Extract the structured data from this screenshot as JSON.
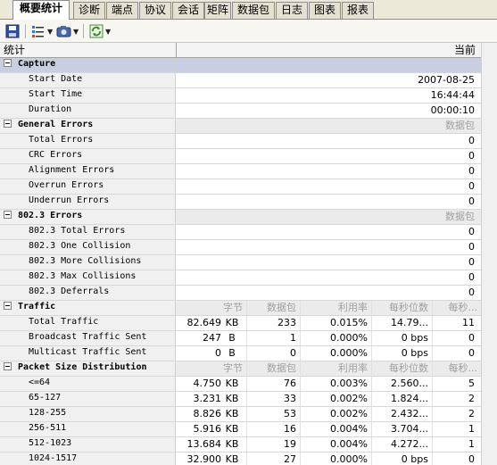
{
  "tabs": [
    "概要统计",
    "诊断",
    "端点",
    "协议",
    "会话",
    "矩阵",
    "数据包",
    "日志",
    "图表",
    "报表"
  ],
  "header": {
    "col_stat": "统计",
    "col_current": "当前"
  },
  "capture": {
    "title": "Capture",
    "start_date_label": "Start Date",
    "start_date": "2007-08-25",
    "start_time_label": "Start Time",
    "start_time": "16:44:44",
    "duration_label": "Duration",
    "duration": "00:00:10"
  },
  "general_errors": {
    "title": "General Errors",
    "unit": "数据包",
    "rows": [
      {
        "label": "Total Errors",
        "value": "0"
      },
      {
        "label": "CRC Errors",
        "value": "0"
      },
      {
        "label": "Alignment Errors",
        "value": "0"
      },
      {
        "label": "Overrun Errors",
        "value": "0"
      },
      {
        "label": "Underrun Errors",
        "value": "0"
      }
    ]
  },
  "errors_8023": {
    "title": "802.3 Errors",
    "unit": "数据包",
    "rows": [
      {
        "label": "802.3 Total Errors",
        "value": "0"
      },
      {
        "label": "802.3 One Collision",
        "value": "0"
      },
      {
        "label": "802.3 More Collisions",
        "value": "0"
      },
      {
        "label": "802.3 Max Collisions",
        "value": "0"
      },
      {
        "label": "802.3 Deferrals",
        "value": "0"
      }
    ]
  },
  "traffic": {
    "title": "Traffic",
    "cols": [
      "字节",
      "数据包",
      "利用率",
      "每秒位数",
      "每秒..."
    ],
    "rows": [
      {
        "label": "Total Traffic",
        "bytes": "82.649",
        "bu": "KB",
        "packets": "233",
        "util": "0.015%",
        "bps": "14.79...",
        "pps": "11"
      },
      {
        "label": "Broadcast Traffic Sent",
        "bytes": "247",
        "bu": "B",
        "packets": "1",
        "util": "0.000%",
        "bps": "0 bps",
        "pps": "0"
      },
      {
        "label": "Multicast Traffic Sent",
        "bytes": "0",
        "bu": "B",
        "packets": "0",
        "util": "0.000%",
        "bps": "0 bps",
        "pps": "0"
      }
    ]
  },
  "psd": {
    "title": "Packet Size Distribution",
    "cols": [
      "字节",
      "数据包",
      "利用率",
      "每秒位数",
      "每秒..."
    ],
    "rows": [
      {
        "label": "<=64",
        "bytes": "4.750",
        "bu": "KB",
        "packets": "76",
        "util": "0.003%",
        "bps": "2.560...",
        "pps": "5"
      },
      {
        "label": "65-127",
        "bytes": "3.231",
        "bu": "KB",
        "packets": "33",
        "util": "0.002%",
        "bps": "1.824...",
        "pps": "2"
      },
      {
        "label": "128-255",
        "bytes": "8.826",
        "bu": "KB",
        "packets": "53",
        "util": "0.002%",
        "bps": "2.432...",
        "pps": "2"
      },
      {
        "label": "256-511",
        "bytes": "5.916",
        "bu": "KB",
        "packets": "16",
        "util": "0.004%",
        "bps": "3.704...",
        "pps": "1"
      },
      {
        "label": "512-1023",
        "bytes": "13.684",
        "bu": "KB",
        "packets": "19",
        "util": "0.004%",
        "bps": "4.272...",
        "pps": "1"
      },
      {
        "label": "1024-1517",
        "bytes": "32.900",
        "bu": "KB",
        "packets": "27",
        "util": "0.000%",
        "bps": "0 bps",
        "pps": "0"
      }
    ]
  }
}
